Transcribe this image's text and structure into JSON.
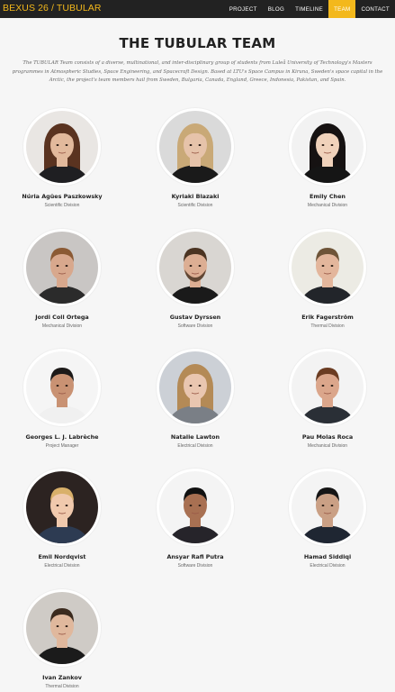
{
  "brand": "BEXUS 26 / TUBULAR",
  "nav": [
    {
      "label": "PROJECT",
      "active": false
    },
    {
      "label": "BLOG",
      "active": false
    },
    {
      "label": "TIMELINE",
      "active": false
    },
    {
      "label": "TEAM",
      "active": true
    },
    {
      "label": "CONTACT",
      "active": false
    }
  ],
  "title": "THE TUBULAR TEAM",
  "intro": "The TUBULAR Team consists of a diverse, multinational, and inter-disciplinary group of students from Luleå University of Technology's Masters programmes in Atmospheric Studies, Space Engineering, and Spacecraft Design. Based at LTU's Space Campus in Kiruna, Sweden's space capital in the Arctic, the project's team members hail from Sweden, Bulgaria, Canada, England, Greece, Indonesia, Pakistan, and Spain.",
  "members": [
    {
      "name": "Núria Agües Paszkowsky",
      "division": "Scientific Division",
      "photo": {
        "bg": "#e9e6e3",
        "skin": "#e2b99c",
        "hair": "#5a3320",
        "shirt": "#1f1f22",
        "hair_style": "long"
      }
    },
    {
      "name": "Kyriaki Blazaki",
      "division": "Scientific Division",
      "photo": {
        "bg": "#dadada",
        "skin": "#e6c3aa",
        "hair": "#c9a977",
        "shirt": "#1a1a1a",
        "hair_style": "long"
      }
    },
    {
      "name": "Emily Chen",
      "division": "Mechanical Division",
      "photo": {
        "bg": "#f2f2f2",
        "skin": "#f0d2bb",
        "hair": "#161212",
        "shirt": "#151515",
        "hair_style": "long"
      }
    },
    {
      "name": "Jordi Coll Ortega",
      "division": "Mechanical Division",
      "photo": {
        "bg": "#c9c6c4",
        "skin": "#d8a88d",
        "hair": "#8b5a34",
        "shirt": "#2b2b2b",
        "hair_style": "short"
      }
    },
    {
      "name": "Gustav Dyrssen",
      "division": "Software Division",
      "photo": {
        "bg": "#d9d6d2",
        "skin": "#dcae93",
        "hair": "#4b3422",
        "shirt": "#1a1a1a",
        "hair_style": "beard"
      }
    },
    {
      "name": "Erik Fagerström",
      "division": "Thermal Division",
      "photo": {
        "bg": "#ecebe4",
        "skin": "#e3b69c",
        "hair": "#6e5438",
        "shirt": "#22252a",
        "hair_style": "short"
      }
    },
    {
      "name": "Georges L. J. Labrèche",
      "division": "Project Manager",
      "photo": {
        "bg": "#f5f5f5",
        "skin": "#c99273",
        "hair": "#1d1a19",
        "shirt": "#f0f0f0",
        "hair_style": "short"
      }
    },
    {
      "name": "Natalie Lawton",
      "division": "Electrical Division",
      "photo": {
        "bg": "#ccd0d6",
        "skin": "#e9c6b0",
        "hair": "#b48a56",
        "shirt": "#7a7f86",
        "hair_style": "long"
      }
    },
    {
      "name": "Pau Molas Roca",
      "division": "Mechanical Division",
      "photo": {
        "bg": "#f3f3f3",
        "skin": "#dba68b",
        "hair": "#6b3c22",
        "shirt": "#2a2f36",
        "hair_style": "short"
      }
    },
    {
      "name": "Emil Nordqvist",
      "division": "Electrical Division",
      "photo": {
        "bg": "#2c2321",
        "skin": "#f0c9ad",
        "hair": "#d9b06a",
        "shirt": "#2d3b52",
        "hair_style": "short"
      }
    },
    {
      "name": "Ansyar Rafi Putra",
      "division": "Software Division",
      "photo": {
        "bg": "#f4f4f4",
        "skin": "#a87052",
        "hair": "#111",
        "shirt": "#26242a",
        "hair_style": "short"
      }
    },
    {
      "name": "Hamad Siddiqi",
      "division": "Electrical Division",
      "photo": {
        "bg": "#f4f4f4",
        "skin": "#caa085",
        "hair": "#151515",
        "shirt": "#1f2632",
        "hair_style": "short"
      }
    },
    {
      "name": "Ivan Zankov",
      "division": "Thermal Division",
      "photo": {
        "bg": "#cfcbc6",
        "skin": "#e0b89d",
        "hair": "#3b2a1e",
        "shirt": "#1b1b1b",
        "hair_style": "short"
      }
    }
  ]
}
